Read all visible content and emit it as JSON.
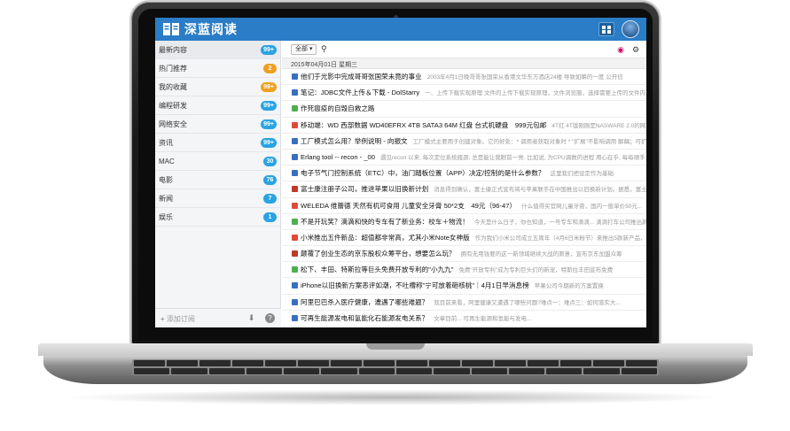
{
  "app": {
    "title": "深蓝阅读",
    "accent": "#2a7dc6"
  },
  "sidebar": {
    "items": [
      {
        "label": "最新内容",
        "count": "99+",
        "color": "#29a3e3"
      },
      {
        "label": "热门推荐",
        "count": "2",
        "color": "#f0a020"
      },
      {
        "label": "我的收藏",
        "count": "99+",
        "color": "#f0a020"
      },
      {
        "label": "编程研发",
        "count": "99+",
        "color": "#29a3e3"
      },
      {
        "label": "网络安全",
        "count": "99+",
        "color": "#29a3e3"
      },
      {
        "label": "资讯",
        "count": "99+",
        "color": "#29a3e3"
      },
      {
        "label": "MAC",
        "count": "30",
        "color": "#29a3e3"
      },
      {
        "label": "电影",
        "count": "76",
        "color": "#29a3e3"
      },
      {
        "label": "新闻",
        "count": "7",
        "color": "#29a3e3"
      },
      {
        "label": "娱乐",
        "count": "1",
        "color": "#29a3e3"
      }
    ],
    "add_subscription": "添加订阅",
    "download_icon": "download-icon",
    "help_icon": "help-icon"
  },
  "toolbar": {
    "filter_label": "全部 ▾",
    "search_icon": "search-icon",
    "settings_icon": "gear-icon"
  },
  "date_header": "2015年04月01日 星期三",
  "articles": [
    {
      "title": "他们于光影中完成哥哥张国荣未竟的事业",
      "snippet": "2003年4月1日晚哥哥张国荣从香港文华东方酒店24楼 导致如瞬的一度 公开信",
      "icon_color": "#3a6fbf"
    },
    {
      "title": "笔记：JDBC文件上传＆下载 - DolStarry",
      "snippet": "一、上传下载实现原理 文件的上传下载实现原理，文件浏览服，选择需要上传的文件内",
      "icon_color": "#3a6fbf"
    },
    {
      "title": "作死瘟疫的自毁自救之路",
      "snippet": "",
      "icon_color": "#4caf50"
    },
    {
      "title": "移动端：WD 西部数据 WD40EFRX 4TB SATA3 64M 红盘 台式机硬盘　999元包邮",
      "snippet": "4T红 4T版刚刚是NASWARE 2.0的网",
      "icon_color": "#e04a3a"
    },
    {
      "title": "工厂模式怎么用？举例说明 - 向振文",
      "snippet": "工厂模式主要用于创建对象。它的好处：* 调用者获取对象时 * \"扩展\"不影响调用 解耦；可扩展",
      "icon_color": "#3a6fbf"
    },
    {
      "title": "Erlang tool -- recon - _00",
      "snippet": "遇见recon 以来, 每次定位系统瓶颈, 总是能让我眼前一亮. 比如说, 为CPU调数的进程 用心在乎, 每每顺手",
      "icon_color": "#3a6fbf"
    },
    {
      "title": "电子节气门控制系统（ETC）中，油门踏板位置（APP）决定/控制的是什么参数？",
      "snippet": "这里我们把设定作为基础",
      "icon_color": "#3a6fbf"
    },
    {
      "title": "富士康注册子公司，推进苹果以旧换新计划",
      "snippet": "消息得到确认，富士康正式宣布将与苹果联手在中国推出以旧换新计划。据悉，富士康正... ",
      "icon_color": "#c0392b"
    },
    {
      "title": "WELEDA 维蕾德 天然有机可食用 儿童安全牙膏 50*2支　49元（96-47）",
      "snippet": "什么值得买官网儿童牙膏，国内一般单价50元...",
      "icon_color": "#e04a3a"
    },
    {
      "title": "不是开玩笑？滴滴和快的专车有了新业务：校车＋物流！",
      "snippet": "今天是什么日子，你也知道，一号专车和滴滴... 滴滴打车公司推出新\"物品运送\"",
      "icon_color": "#4caf50"
    },
    {
      "title": "小米推出五件新品：超值都非常高，尤其小米Note女神版",
      "snippet": "作为我们小米公司成立五周年（4月6日米粉节）来推出5款新产品，包括小米",
      "icon_color": "#e04a3a"
    },
    {
      "title": "颠覆了创业生态的京东股权众筹平台，想要怎么玩？",
      "snippet": "拥有无用钱要的这一新领域继续大战的原意，宣布京东加盟众筹",
      "icon_color": "#c0392b"
    },
    {
      "title": "松下、丰田、特斯拉等巨头免费开放专利的\"小九九\"",
      "snippet": "免费\"开放专利\"成为专利巨头们的新宠，特斯拉丰田宣布免费",
      "icon_color": "#4caf50"
    },
    {
      "title": "iPhone以旧换新方案恶评如潮，不吐槽称\"宁可放着砸核桃\"｜4月1日早消息榜",
      "snippet": "苹果公司今期新的方案置换",
      "icon_color": "#3a6fbf"
    },
    {
      "title": "阿里巴巴杀入医疗健康，遭遇了哪些难题？",
      "snippet": "就目前来看，阿里健康又遭遇了哪些问题?难点一：难点三：如何落实大...",
      "icon_color": "#3a6fbf"
    },
    {
      "title": "可再生能源发电和氢能化石能源发电关系？",
      "snippet": "文章目前... 可再生能源和氢能与发电...",
      "icon_color": "#3a6fbf"
    }
  ]
}
